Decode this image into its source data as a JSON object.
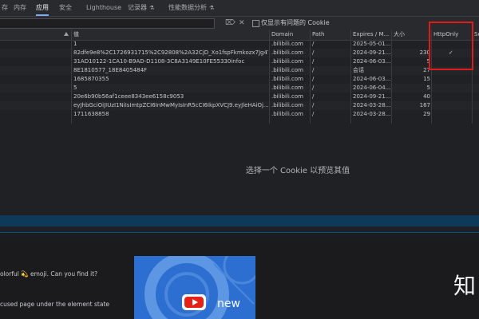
{
  "tabs": [
    {
      "label": "存",
      "active": false
    },
    {
      "label": "内存",
      "active": false
    },
    {
      "label": "应用",
      "active": true
    },
    {
      "label": "安全",
      "active": false
    },
    {
      "label": "Lighthouse",
      "active": false
    },
    {
      "label": "记录器",
      "active": false,
      "icon": "flask-icon"
    },
    {
      "label": "性能数据分析",
      "active": false,
      "icon": "flask-icon"
    }
  ],
  "filterbar": {
    "clear_glyph": "⌦",
    "close_glyph": "✕",
    "checkbox_label": "仅显示有问题的 Cookie",
    "checkbox_checked": false
  },
  "table": {
    "headers": [
      "值",
      "Domain",
      "Path",
      "Expires / M...",
      "大小",
      "HttpOnly",
      "Se"
    ],
    "rows": [
      {
        "value": "1",
        "domain": ".bilibili.com",
        "path": "/",
        "expires": "2025-05-01...",
        "size": "",
        "httponly": ""
      },
      {
        "value": "82dfe9e8%2C1726931715%2C92808%2A32CjD_Xo1fspFkmkozx7Jg4Y...",
        "domain": ".bilibili.com",
        "path": "/",
        "expires": "2024-09-21...",
        "size": "230",
        "httponly": "✓"
      },
      {
        "value": "31AD10122-1CA10-B9AD-D1108-3C8A3149E10FE55330infoc",
        "domain": ".bilibili.com",
        "path": "/",
        "expires": "2024-06-03...",
        "size": "5",
        "httponly": ""
      },
      {
        "value": "8E1810577_18E8405484F",
        "domain": ".bilibili.com",
        "path": "/",
        "expires": "会话",
        "size": "27",
        "httponly": ""
      },
      {
        "value": "1685870355",
        "domain": ".bilibili.com",
        "path": "/",
        "expires": "2024-06-03...",
        "size": "15",
        "httponly": ""
      },
      {
        "value": "5",
        "domain": ".bilibili.com",
        "path": "/",
        "expires": "2024-06-04...",
        "size": "5",
        "httponly": ""
      },
      {
        "value": "20e6b90b56af1ceee8343ee6158c9053",
        "domain": ".bilibili.com",
        "path": "/",
        "expires": "2024-09-21...",
        "size": "40",
        "httponly": ""
      },
      {
        "value": "eyJhbGciOiJIUzI1NiIsImtpZCI6InMwMyIsInR5cCI6IkpXVCJ9.eyJleHAiOj...",
        "domain": ".bilibili.com",
        "path": "/",
        "expires": "2024-03-28...",
        "size": "167",
        "httponly": ""
      },
      {
        "value": "1711638858",
        "domain": ".bilibili.com",
        "path": "/",
        "expires": "2024-03-28...",
        "size": "29",
        "httponly": ""
      }
    ]
  },
  "preview": {
    "message": "选择一个 Cookie 以预览其值"
  },
  "page": {
    "line1_prefix": "olorful",
    "line1_emoji": "💫",
    "line1_suffix": "emoji. Can you find it?",
    "line2": "cused page under the element state",
    "video_text": "new",
    "big_char": "知"
  },
  "colors": {
    "accent": "#7cacf8",
    "highlight": "#e11b1b",
    "thumb": "#2c6fd0"
  }
}
